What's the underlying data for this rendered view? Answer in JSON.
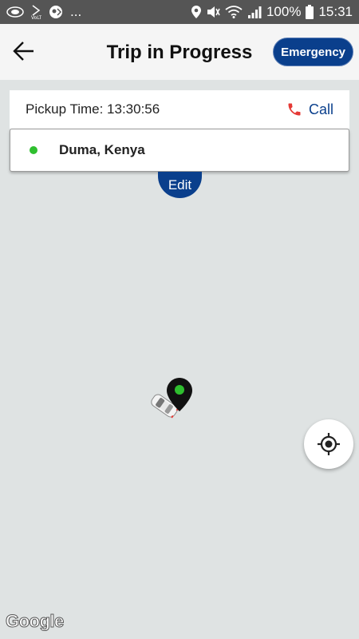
{
  "status_bar": {
    "ellipsis": "...",
    "battery": "100%",
    "time": "15:31"
  },
  "header": {
    "title": "Trip in Progress",
    "emergency_label": "Emergency"
  },
  "trip": {
    "pickup_label": "Pickup Time: 13:30:56",
    "call_label": "Call",
    "destination": "Duma, Kenya",
    "edit_label": "Edit"
  },
  "map": {
    "attribution": "Google"
  },
  "colors": {
    "primary": "#0a3f8c",
    "destination_dot": "#2fbf2f",
    "phone_icon": "#e53935"
  }
}
